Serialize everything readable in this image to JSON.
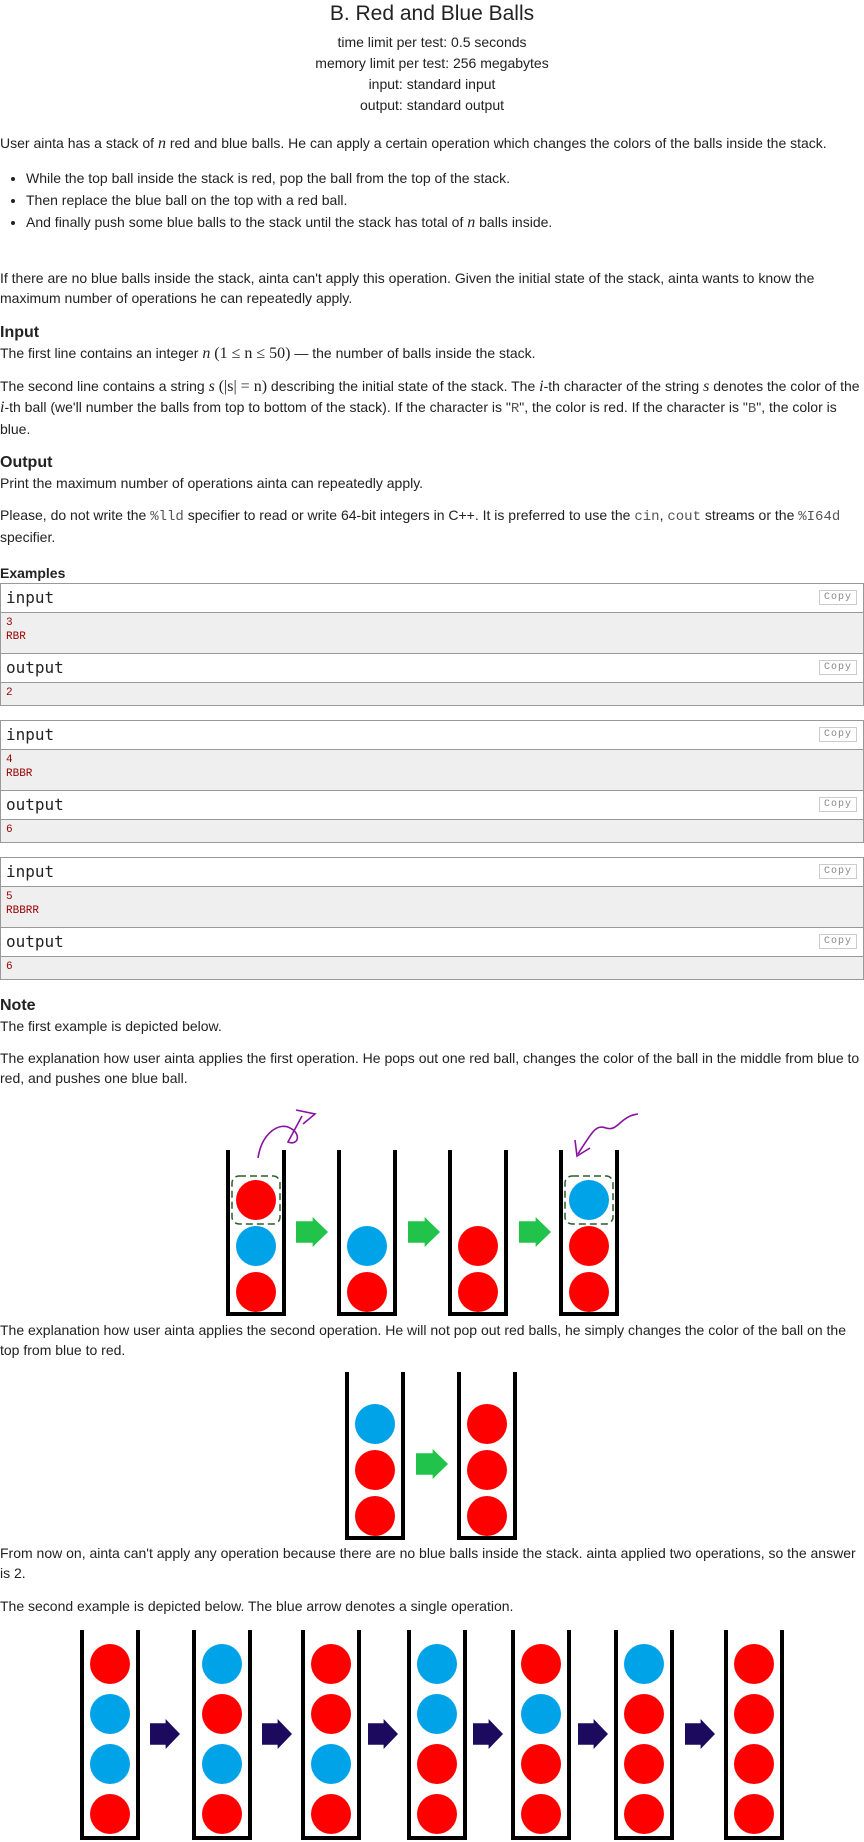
{
  "header": {
    "title": "B. Red and Blue Balls",
    "time_limit": "time limit per test: 0.5 seconds",
    "memory_limit": "memory limit per test: 256 megabytes",
    "input": "input: standard input",
    "output": "output: standard output"
  },
  "legend": {
    "p1_a": "User ainta has a stack of ",
    "p1_n": "n",
    "p1_b": " red and blue balls. He can apply a certain operation which changes the colors of the balls inside the stack.",
    "op1": "While the top ball inside the stack is red, pop the ball from the top of the stack.",
    "op2": "Then replace the blue ball on the top with a red ball.",
    "op3_a": "And finally push some blue balls to the stack until the stack has total of ",
    "op3_n": "n",
    "op3_b": " balls inside.",
    "p2": "If there are no blue balls inside the stack, ainta can't apply this operation. Given the initial state of the stack, ainta wants to know the maximum number of operations he can repeatedly apply."
  },
  "input_spec": {
    "heading": "Input",
    "l1_a": "The first line contains an integer ",
    "l1_n": "n",
    "l1_range": "(1 ≤ n ≤ 50)",
    "l1_b": " — the number of balls inside the stack.",
    "l2_a": "The second line contains a string ",
    "l2_s": "s",
    "l2_cond": "(|s| = n)",
    "l2_b": " describing the initial state of the stack. The ",
    "l2_i": "i",
    "l2_c": "-th character of the string ",
    "l2_s2": "s",
    "l2_d": " denotes the color of the ",
    "l2_i2": "i",
    "l2_e": "-th ball (we'll number the balls from top to bottom of the stack). If the character is \"",
    "l2_R": "R",
    "l2_f": "\", the color is red. If the character is \"",
    "l2_B": "B",
    "l2_g": "\", the color is blue."
  },
  "output_spec": {
    "heading": "Output",
    "l1": "Print the maximum number of operations ainta can repeatedly apply.",
    "l2_a": "Please, do not write the ",
    "l2_lld": "%lld",
    "l2_b": " specifier to read or write 64-bit integers in C++. It is preferred to use the ",
    "l2_cin": "cin",
    "l2_c": ", ",
    "l2_cout": "cout",
    "l2_d": " streams or the ",
    "l2_i64": "%I64d",
    "l2_e": " specifier."
  },
  "examples": {
    "heading": "Examples",
    "input_label": "input",
    "output_label": "output",
    "copy_label": "Copy",
    "items": [
      {
        "input": [
          "3",
          "RBR"
        ],
        "output": [
          "2"
        ]
      },
      {
        "input": [
          "4",
          "RBBR"
        ],
        "output": [
          "6"
        ]
      },
      {
        "input": [
          "5",
          "RBBRR"
        ],
        "output": [
          "6"
        ]
      }
    ]
  },
  "note": {
    "heading": "Note",
    "n1": "The first example is depicted below.",
    "n2": "The explanation how user ainta applies the first operation. He pops out one red ball, changes the color of the ball in the middle from blue to red, and pushes one blue ball.",
    "n3": "The explanation how user ainta applies the second operation. He will not pop out red balls, he simply changes the color of the ball on the top from blue to red.",
    "n4": "From now on, ainta can't apply any operation because there are no blue balls inside the stack. ainta applied two operations, so the answer is 2.",
    "n5": "The second example is depicted below. The blue arrow denotes a single operation."
  },
  "colors": {
    "red_ball": "#ff0000",
    "blue_ball": "#00a2e8",
    "green_arrow": "#22c34a",
    "navy_arrow": "#1c0a5e",
    "curve": "#8a12a0",
    "dash": "#2d5d2d"
  },
  "figures": {
    "fig1": [
      [
        "R",
        "B",
        "R"
      ],
      [
        "B",
        "R"
      ],
      [
        "R",
        "R"
      ],
      [
        "B",
        "R",
        "R"
      ]
    ],
    "fig2": [
      [
        "B",
        "R",
        "R"
      ],
      [
        "R",
        "R",
        "R"
      ]
    ],
    "fig3": [
      [
        "R",
        "B",
        "B",
        "R"
      ],
      [
        "B",
        "R",
        "B",
        "R"
      ],
      [
        "R",
        "R",
        "B",
        "R"
      ],
      [
        "B",
        "B",
        "R",
        "R"
      ],
      [
        "R",
        "B",
        "R",
        "R"
      ],
      [
        "B",
        "R",
        "R",
        "R"
      ],
      [
        "R",
        "R",
        "R",
        "R"
      ]
    ]
  }
}
